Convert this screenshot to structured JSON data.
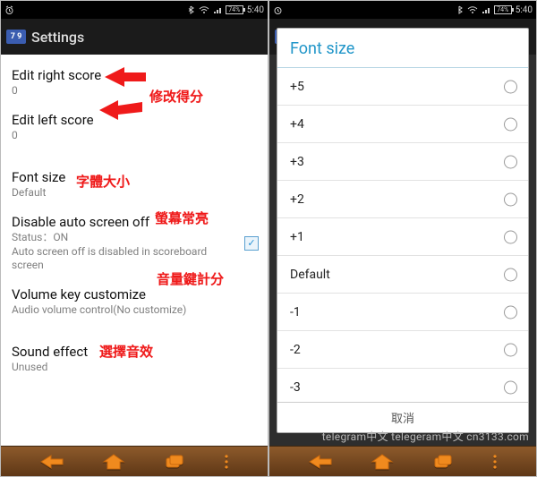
{
  "statusbar": {
    "battery": "74%",
    "time": "5:40"
  },
  "appbar": {
    "logo_text": "7 9",
    "title": "Settings"
  },
  "left": {
    "edit_right": {
      "label": "Edit right score",
      "value": "0"
    },
    "edit_left": {
      "label": "Edit left score",
      "value": "0"
    },
    "font_size": {
      "label": "Font size",
      "value": "Default"
    },
    "disable_screen": {
      "label": "Disable auto screen off",
      "status": "Status：ON",
      "desc": "Auto screen off is disabled in scoreboard screen",
      "checked": true
    },
    "volume": {
      "label": "Volume key customize",
      "desc": "Audio volume control(No customize)"
    },
    "sound": {
      "label": "Sound effect",
      "value": "Unused"
    }
  },
  "annotations": {
    "edit_score": "修改得分",
    "font_size": "字體大小",
    "screen": "螢幕常亮",
    "volume": "音量鍵計分",
    "sound": "選擇音效"
  },
  "dialog": {
    "title": "Font size",
    "options": [
      "+5",
      "+4",
      "+3",
      "+2",
      "+1",
      "Default",
      "-1",
      "-2",
      "-3"
    ],
    "cancel": "取消"
  },
  "watermark": "telegram中文 telegeram中文 cn3133.com"
}
